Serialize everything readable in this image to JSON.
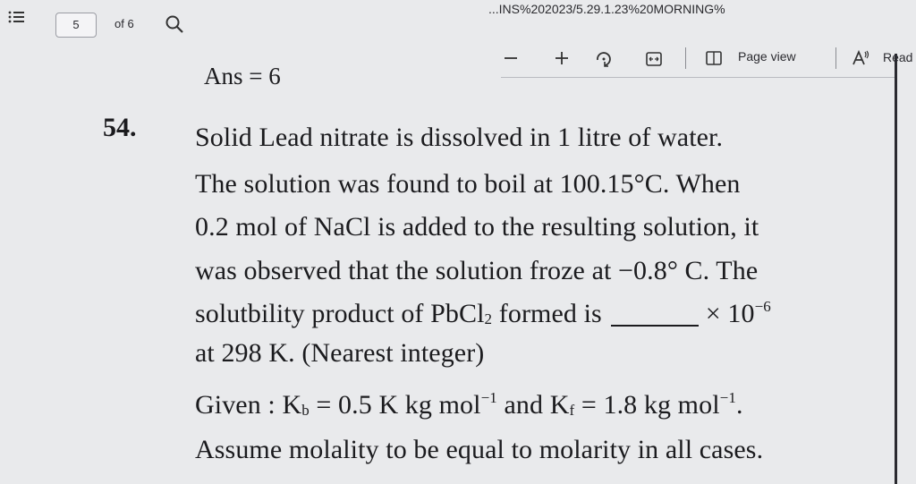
{
  "toolbar": {
    "page_number": "5",
    "page_of": "of 6",
    "url_fragment": "...INS%202023/5.29.1.23%20MORNING%",
    "page_view_label": "Page view",
    "read_label": "Read"
  },
  "document": {
    "ans_line": "Ans = 6",
    "question_number": "54.",
    "line1": "Solid Lead nitrate is dissolved in 1 litre of water.",
    "line2": "The solution was found to boil at 100.15°C. When",
    "line3": "0.2 mol of NaCl is added to the resulting solution, it",
    "line4": "was observed that the solution froze at −0.8° C. The",
    "line5_a": "solutbility product of PbCl",
    "line5_sub": "2",
    "line5_b": " formed is",
    "line5_c": "× 10",
    "line5_sup": "−6",
    "line6": "at 298 K. (Nearest integer)",
    "line7_a": "Given : K",
    "line7_sub1": "b",
    "line7_b": " = 0.5 K kg mol",
    "line7_sup1": "−1",
    "line7_c": " and K",
    "line7_sub2": "f",
    "line7_d": " = 1.8 kg mol",
    "line7_sup2": "−1",
    "line7_e": ".",
    "line8": "Assume molality to be equal to molarity in all cases."
  }
}
